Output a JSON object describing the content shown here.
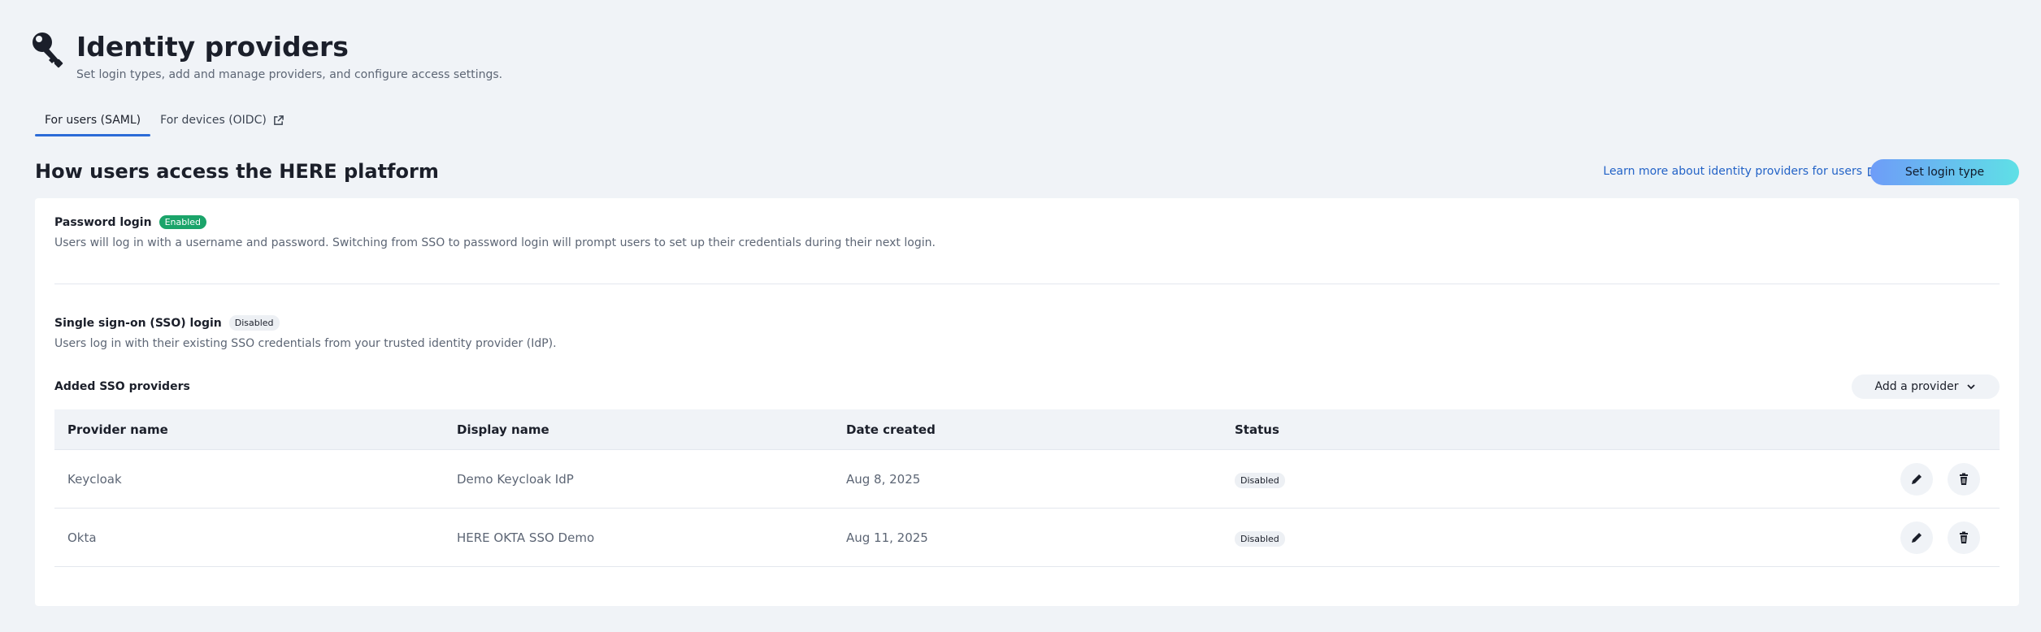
{
  "header": {
    "title": "Identity providers",
    "subtitle": "Set login types, add and manage providers, and configure access settings.",
    "icon": "key-icon"
  },
  "tabs": [
    {
      "label": "For users (SAML)",
      "active": true
    },
    {
      "label": "For devices (OIDC)",
      "active": false,
      "icon": "external-link-icon"
    }
  ],
  "section": {
    "title": "How users access the HERE platform",
    "learn_more": "Learn more about identity providers for users",
    "set_login_label": "Set login type"
  },
  "password_login": {
    "label": "Password login",
    "badge": "Enabled",
    "description": "Users will log in with a username and password. Switching from SSO to password login will prompt users to set up their credentials during their next login."
  },
  "sso_login": {
    "label": "Single sign-on (SSO) login",
    "badge": "Disabled",
    "description": "Users log in with their existing SSO credentials from your trusted identity provider (IdP)."
  },
  "providers": {
    "label": "Added SSO providers",
    "add_label": "Add a provider",
    "columns": [
      "Provider name",
      "Display name",
      "Date created",
      "Status"
    ],
    "rows": [
      {
        "provider": "Keycloak",
        "display": "Demo Keycloak IdP",
        "date": "Aug 8, 2025",
        "status": "Disabled"
      },
      {
        "provider": "Okta",
        "display": "HERE OKTA SSO Demo",
        "date": "Aug 11, 2025",
        "status": "Disabled"
      }
    ]
  },
  "colors": {
    "accent": "#2b6bd7",
    "link": "#2363c7",
    "enabled": "#1ba46a",
    "background": "#f0f3f7"
  }
}
